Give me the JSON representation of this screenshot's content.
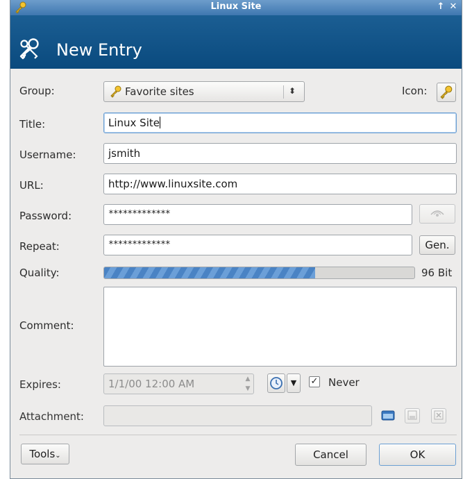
{
  "window": {
    "title": "Linux Site",
    "controls": [
      "↑",
      "✕"
    ]
  },
  "banner": {
    "title": "New Entry",
    "icon": "keys-icon"
  },
  "group": {
    "label": "Group:",
    "value": "Favorite sites",
    "icon": "key-icon"
  },
  "icon_field": {
    "label": "Icon:",
    "icon": "key-icon"
  },
  "title": {
    "label": "Title:",
    "value": "Linux Site"
  },
  "username": {
    "label": "Username:",
    "value": "jsmith"
  },
  "url": {
    "label": "URL:",
    "value": "http://www.linuxsite.com"
  },
  "password": {
    "label": "Password:",
    "value": "*************",
    "reveal_icon": "eye-icon"
  },
  "repeat": {
    "label": "Repeat:",
    "value": "*************",
    "gen_label": "Gen."
  },
  "quality": {
    "label": "Quality:",
    "percent": 68,
    "value_text": "96 Bit"
  },
  "comment": {
    "label": "Comment:",
    "value": ""
  },
  "expires": {
    "label": "Expires:",
    "value": "1/1/00 12:00 AM",
    "never_label": "Never",
    "never_checked": true
  },
  "attachment": {
    "label": "Attachment:",
    "value": ""
  },
  "footer": {
    "tools_label": "Tools",
    "cancel_label": "Cancel",
    "ok_label": "OK"
  },
  "colors": {
    "titlebar": "#5a8cc0",
    "banner": "#0d4f85",
    "progress": "#4a83c4",
    "window_bg": "#edeceb"
  }
}
